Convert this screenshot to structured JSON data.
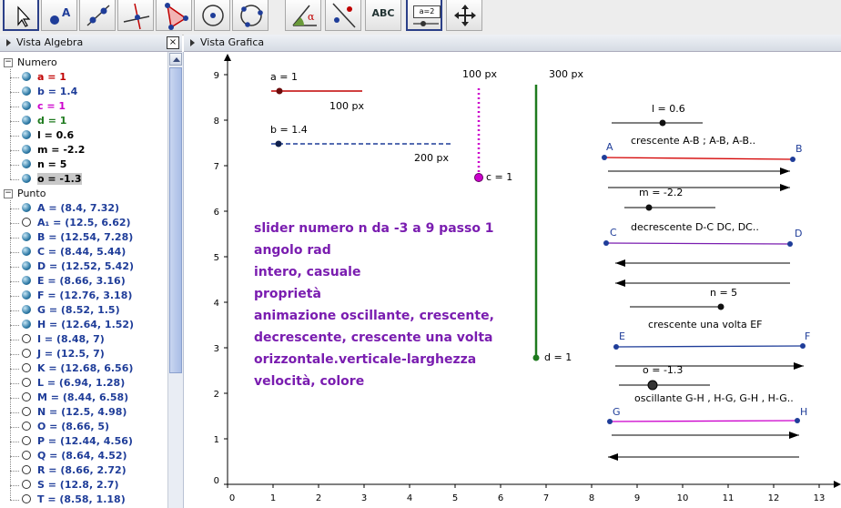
{
  "toolbar": {
    "tools": [
      "pointer-tool",
      "point-tool",
      "line-tool",
      "perpendicular-tool",
      "polygon-tool",
      "circle-tool",
      "circle-three-points-tool",
      "angle-tool",
      "reflect-tool",
      "text-tool",
      "slider-tool",
      "move-view-tool"
    ],
    "text_label": "ABC",
    "slider_label": "a=2"
  },
  "algebra": {
    "title": "Vista Algebra",
    "close": "×",
    "groups": [
      {
        "name": "Numero",
        "items": [
          {
            "label": "a = 1",
            "color": "#c00000",
            "shown": true
          },
          {
            "label": "b = 1.4",
            "color": "#1f3d99",
            "shown": true
          },
          {
            "label": "c = 1",
            "color": "#cc00cc",
            "shown": true
          },
          {
            "label": "d = 1",
            "color": "#1e7a1e",
            "shown": true
          },
          {
            "label": "l = 0.6",
            "color": "#000000",
            "shown": true
          },
          {
            "label": "m = -2.2",
            "color": "#000000",
            "shown": true
          },
          {
            "label": "n = 5",
            "color": "#000000",
            "shown": true
          },
          {
            "label": "o = -1.3",
            "color": "#000000",
            "shown": true,
            "highlight": true
          }
        ]
      },
      {
        "name": "Punto",
        "items": [
          {
            "label": "A = (8.4, 7.32)",
            "color": "#1f3d99",
            "shown": true
          },
          {
            "label": "A₁ = (12.5, 6.62)",
            "color": "#1f3d99",
            "shown": false
          },
          {
            "label": "B = (12.54, 7.28)",
            "color": "#1f3d99",
            "shown": true
          },
          {
            "label": "C = (8.44, 5.44)",
            "color": "#1f3d99",
            "shown": true
          },
          {
            "label": "D = (12.52, 5.42)",
            "color": "#1f3d99",
            "shown": true
          },
          {
            "label": "E = (8.66, 3.16)",
            "color": "#1f3d99",
            "shown": true
          },
          {
            "label": "F = (12.76, 3.18)",
            "color": "#1f3d99",
            "shown": true
          },
          {
            "label": "G = (8.52, 1.5)",
            "color": "#1f3d99",
            "shown": true
          },
          {
            "label": "H = (12.64, 1.52)",
            "color": "#1f3d99",
            "shown": true
          },
          {
            "label": "I = (8.48, 7)",
            "color": "#1f3d99",
            "shown": false
          },
          {
            "label": "J = (12.5, 7)",
            "color": "#1f3d99",
            "shown": false
          },
          {
            "label": "K = (12.68, 6.56)",
            "color": "#1f3d99",
            "shown": false
          },
          {
            "label": "L = (6.94, 1.28)",
            "color": "#1f3d99",
            "shown": false
          },
          {
            "label": "M = (8.44, 6.58)",
            "color": "#1f3d99",
            "shown": false
          },
          {
            "label": "N = (12.5, 4.98)",
            "color": "#1f3d99",
            "shown": false
          },
          {
            "label": "O = (8.66, 5)",
            "color": "#1f3d99",
            "shown": false
          },
          {
            "label": "P = (12.44, 4.56)",
            "color": "#1f3d99",
            "shown": false
          },
          {
            "label": "Q = (8.64, 4.52)",
            "color": "#1f3d99",
            "shown": false
          },
          {
            "label": "R = (8.66, 2.72)",
            "color": "#1f3d99",
            "shown": false
          },
          {
            "label": "S = (12.8, 2.7)",
            "color": "#1f3d99",
            "shown": false
          },
          {
            "label": "T = (8.58, 1.18)",
            "color": "#1f3d99",
            "shown": false
          }
        ]
      }
    ]
  },
  "graphics": {
    "title": "Vista Grafica",
    "x_ticks": [
      "0",
      "1",
      "2",
      "3",
      "4",
      "5",
      "6",
      "7",
      "8",
      "9",
      "10",
      "11",
      "12",
      "13"
    ],
    "y_ticks": [
      "0",
      "1",
      "2",
      "3",
      "4",
      "5",
      "6",
      "7",
      "8",
      "9"
    ],
    "sliders": {
      "a": {
        "label": "a = 1",
        "px": "100 px",
        "color": "#c00000"
      },
      "b": {
        "label": "b = 1.4",
        "px": "200 px",
        "color": "#1f3d99"
      },
      "c": {
        "label": "c = 1",
        "px": "100 px",
        "color": "#cc00cc"
      },
      "d": {
        "label": "d = 1",
        "px": "300 px",
        "color": "#1e7a1e"
      },
      "l": {
        "label": "l = 0.6"
      },
      "m": {
        "label": "m = -2.2"
      },
      "n": {
        "label": "n = 5"
      },
      "o": {
        "label": "o = -1.3"
      }
    },
    "points": {
      "A": "A",
      "B": "B",
      "C": "C",
      "D": "D",
      "E": "E",
      "F": "F",
      "G": "G",
      "H": "H"
    },
    "captions": {
      "ab": "crescente A-B ; A-B, A-B..",
      "cd": "decrescente D-C DC, DC..",
      "ef": "crescente una volta  EF",
      "gh": "oscillante G-H , H-G, G-H , H-G.."
    },
    "note": [
      "slider numero n da -3 a 9 passo 1",
      "angolo rad",
      "intero, casuale",
      "proprietà",
      "animazione oscillante, crescente,",
      "decrescente, crescente una volta",
      "orizzontale.verticale-larghezza",
      "velocità, colore"
    ]
  }
}
